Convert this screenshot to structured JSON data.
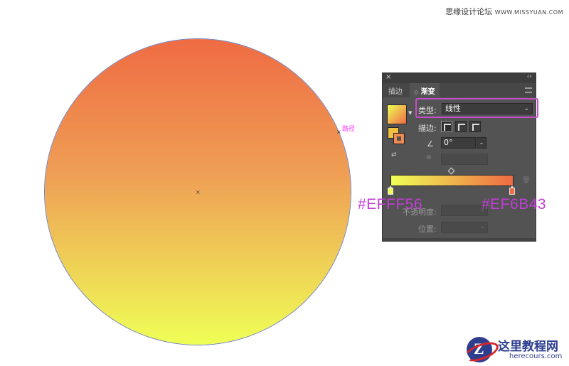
{
  "watermark": {
    "site_cn": "思缘设计论坛",
    "site_url": "WWW.MISSYUAN.COM"
  },
  "canvas": {
    "path_label": "路径",
    "gradient_colors": {
      "start": "#EFFF56",
      "end": "#EF6B43",
      "outline": "#6f7fbf"
    },
    "center_marker": "×",
    "anchor_marker": "×"
  },
  "annotations": {
    "left_color": "#EFFF56",
    "right_color": "#EF6B43",
    "color": "#c23dd6"
  },
  "panel": {
    "title_close": "×",
    "title_collapse": "‹‹",
    "tabs": [
      {
        "label": "描边"
      },
      {
        "label": "渐变",
        "prefix": "◇"
      }
    ],
    "type_label": "类型:",
    "type_value": "线性",
    "stroke_label": "描边:",
    "angle_value": "0°",
    "opacity_label": "不透明度:",
    "location_label": "位置:",
    "icons": [
      "gradient-swatch-icon",
      "fill-stroke-icon",
      "reverse-gradient-icon",
      "angle-icon",
      "aspect-ratio-icon",
      "trash-icon",
      "panel-menu-icon"
    ]
  },
  "logo": {
    "cn": "这里教程网",
    "en": "herecours.com",
    "letter": "Z",
    "colors": {
      "blue": "#2d3e8f",
      "red": "#d6262c"
    }
  }
}
